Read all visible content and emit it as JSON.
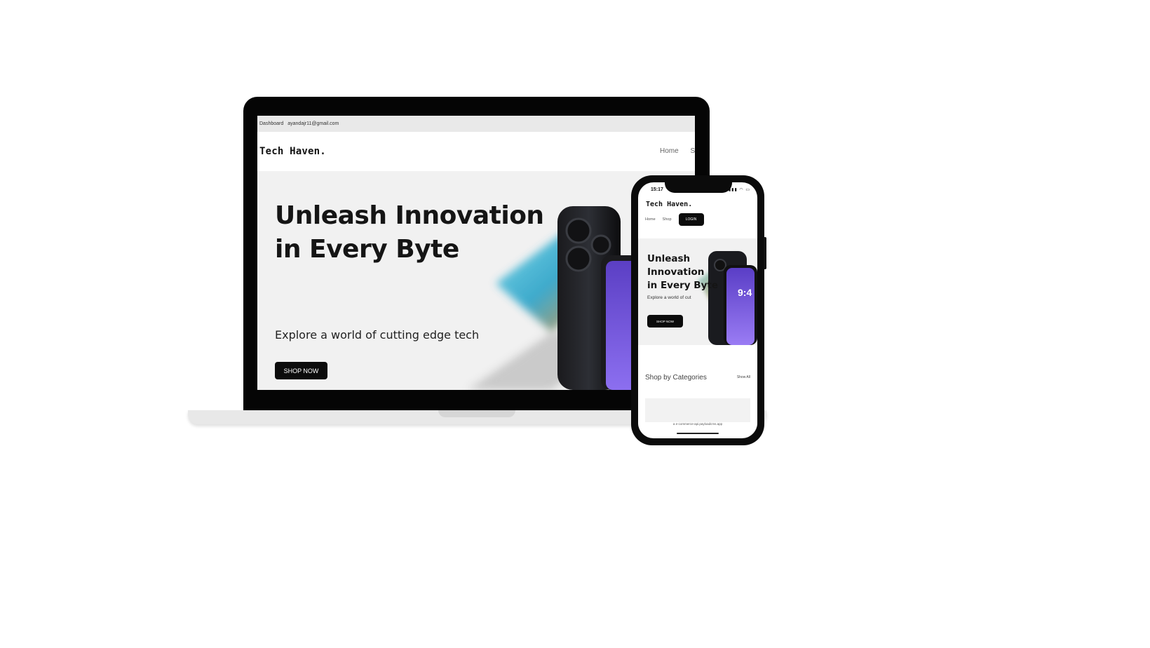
{
  "laptop": {
    "topbar": {
      "dashboard": "Dashboard",
      "email": "ayandajr11@gmail.com"
    },
    "header": {
      "logo": "Tech Haven.",
      "nav": [
        "Home",
        "Sh"
      ]
    },
    "hero": {
      "title_line1": "Unleash Innovation",
      "title_line2": "in Every Byte",
      "subtitle": "Explore a world of cutting edge tech",
      "button": "SHOP NOW"
    }
  },
  "phone": {
    "status": {
      "time": "15:17"
    },
    "header": {
      "logo": "Tech Haven.",
      "nav_home": "Home",
      "nav_shop": "Shop",
      "login": "LOGIN"
    },
    "hero": {
      "title_line1": "Unleash",
      "title_line2": "Innovation",
      "title_line3": "in Every Byte",
      "subtitle": "Explore a world of cut",
      "button": "SHOP NOW",
      "screen_time": "9:4"
    },
    "categories": {
      "title": "Shop by Categories",
      "show_all": "Show All"
    },
    "url_bar": "a e-commerce-api.payloadcms.app"
  },
  "colors": {
    "accent": "#0c0c0c",
    "hero_bg": "#f1f1f1",
    "device_frame": "#050505"
  }
}
